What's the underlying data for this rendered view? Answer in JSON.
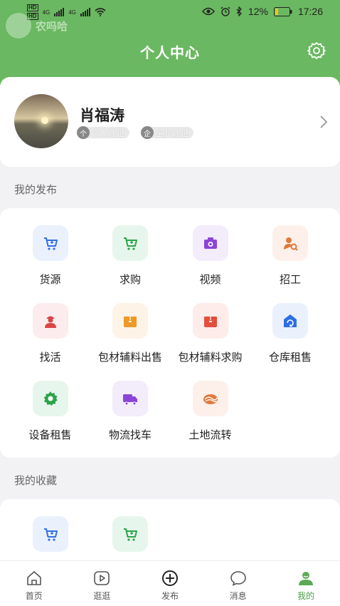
{
  "status_bar": {
    "net1": "4G",
    "net2": "4G",
    "battery": "12%",
    "time": "17:26"
  },
  "watermark": "农吗哈",
  "header": {
    "title": "个人中心",
    "settings_icon": "gear-icon"
  },
  "profile": {
    "name": "肖福涛",
    "personal_cert": "个人认证",
    "company_cert": "企业认证"
  },
  "sections": {
    "publish": "我的发布",
    "favorites": "我的收藏"
  },
  "publish_items": [
    {
      "label": "货源",
      "icon": "cart-icon",
      "color": "#2f6fe4",
      "bg": "#eaf1fd"
    },
    {
      "label": "求购",
      "icon": "cart-icon",
      "color": "#2aa44a",
      "bg": "#e7f6ec"
    },
    {
      "label": "视频",
      "icon": "camera-icon",
      "color": "#8c45d6",
      "bg": "#f2ecfb"
    },
    {
      "label": "招工",
      "icon": "worker-search-icon",
      "color": "#e0793c",
      "bg": "#fdf0ea"
    },
    {
      "label": "找活",
      "icon": "worker-icon",
      "color": "#d94545",
      "bg": "#fdeced"
    },
    {
      "label": "包材辅料出售",
      "icon": "box-icon",
      "color": "#ec9a2a",
      "bg": "#fdf3e6"
    },
    {
      "label": "包材辅料求购",
      "icon": "box-icon",
      "color": "#e2503d",
      "bg": "#fdece9"
    },
    {
      "label": "仓库租售",
      "icon": "warehouse-icon",
      "color": "#2f6fe4",
      "bg": "#eaf1fd"
    },
    {
      "label": "设备租售",
      "icon": "gear-icon",
      "color": "#2aa44a",
      "bg": "#e7f6ec"
    },
    {
      "label": "物流找车",
      "icon": "truck-icon",
      "color": "#8c45d6",
      "bg": "#f2ecfb"
    },
    {
      "label": "土地流转",
      "icon": "land-icon",
      "color": "#e0793c",
      "bg": "#fdf0ea"
    }
  ],
  "favorite_items": [
    {
      "label": "",
      "icon": "cart-icon",
      "color": "#2f6fe4",
      "bg": "#eaf1fd"
    },
    {
      "label": "",
      "icon": "cart-icon",
      "color": "#2aa44a",
      "bg": "#e7f6ec"
    }
  ],
  "tabs": [
    {
      "label": "首页",
      "icon": "home-icon"
    },
    {
      "label": "逛逛",
      "icon": "play-icon"
    },
    {
      "label": "发布",
      "icon": "plus-circle-icon"
    },
    {
      "label": "消息",
      "icon": "message-icon"
    },
    {
      "label": "我的",
      "icon": "user-icon",
      "active": true
    }
  ]
}
